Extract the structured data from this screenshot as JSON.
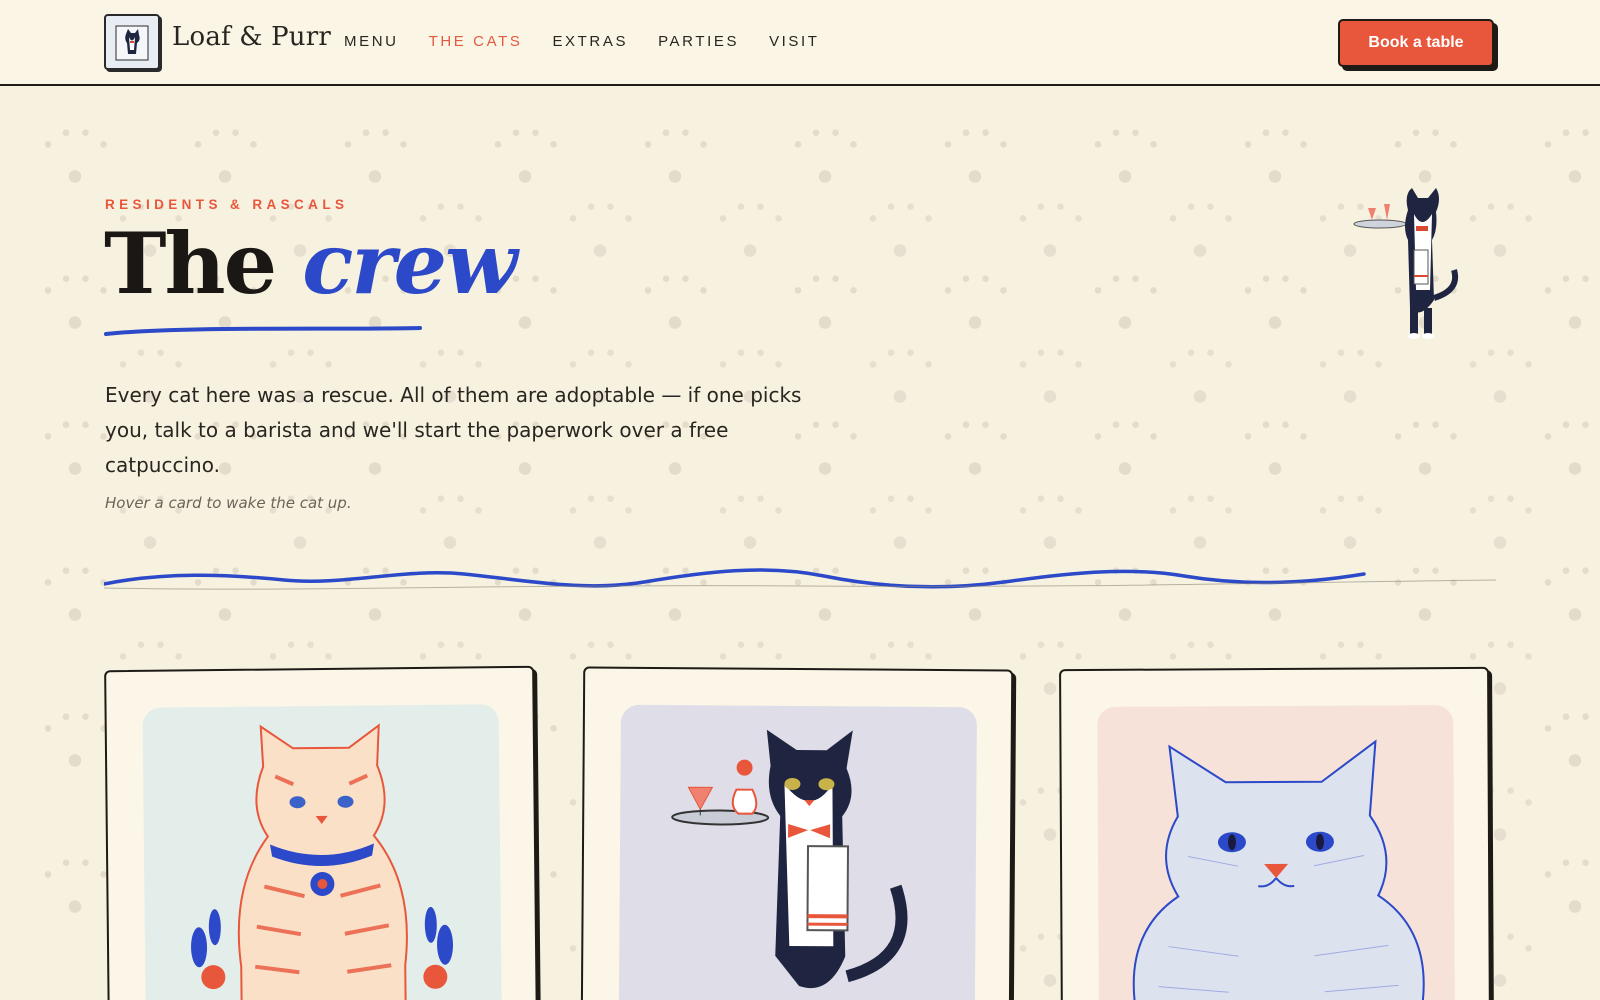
{
  "brand": {
    "name": "Loaf & Purr",
    "logo_icon": "cat-logo-icon"
  },
  "nav": {
    "items": [
      {
        "label": "MENU",
        "active": false
      },
      {
        "label": "THE CATS",
        "active": true
      },
      {
        "label": "EXTRAS",
        "active": false
      },
      {
        "label": "PARTIES",
        "active": false
      },
      {
        "label": "VISIT",
        "active": false
      }
    ],
    "cta": "Book a table"
  },
  "hero": {
    "eyebrow": "RESIDENTS & RASCALS",
    "title_plain": "The",
    "title_accent": "crew",
    "intro": "Every cat here was a rescue. All of them are adoptable — if one picks you, talk to a barista and we'll start the paperwork over a free catpuccino.",
    "hint": "Hover a card to wake the cat up."
  },
  "colors": {
    "accent": "#e8573c",
    "blue": "#2b49c8",
    "ink": "#1e1a16",
    "paper": "#f7f1df"
  },
  "cards": [
    {
      "illustration": "orange-tabby-cat-illustration",
      "bg": "#e3ede9"
    },
    {
      "illustration": "tuxedo-waiter-cat-illustration",
      "bg": "#dfdde8"
    },
    {
      "illustration": "grey-british-shorthair-illustration",
      "bg": "#f6e2d8"
    }
  ]
}
